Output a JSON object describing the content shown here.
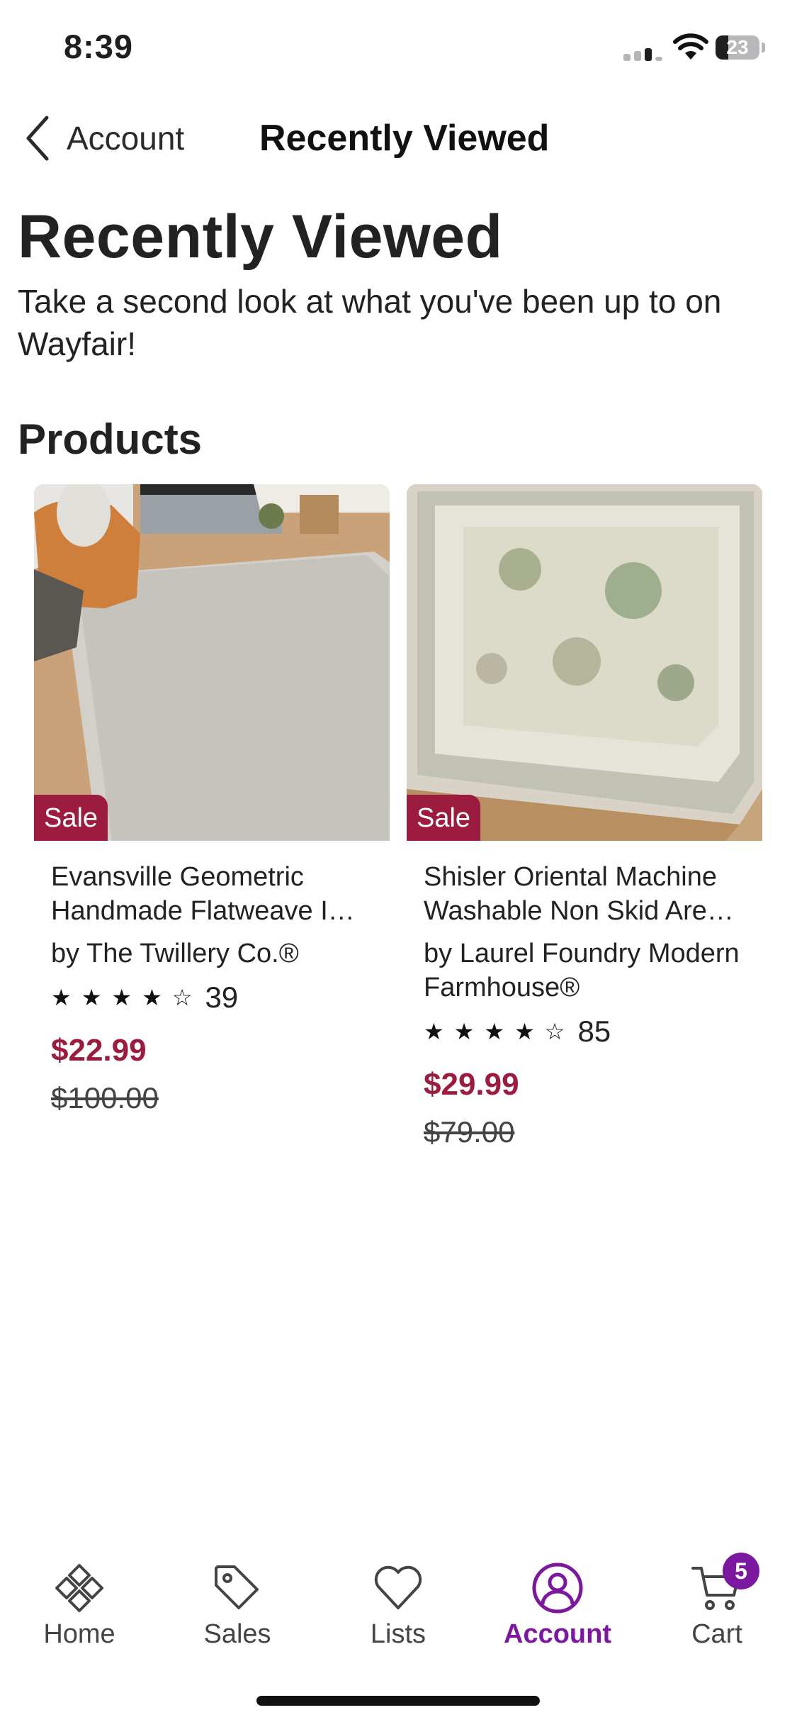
{
  "status_bar": {
    "time": "8:39",
    "battery": "23"
  },
  "nav": {
    "back_label": "Account",
    "title": "Recently Viewed"
  },
  "page": {
    "title": "Recently Viewed",
    "subtitle": "Take a second look at what you've been up to on Wayfair!",
    "section_title": "Products"
  },
  "products": [
    {
      "badge": "Sale",
      "name": "Evansville Geometric Handmade Flatweave I…",
      "brand": "by The Twillery Co.®",
      "stars": "★★★★☆",
      "rating": 4,
      "review_count": "39",
      "price": "$22.99",
      "original_price": "$100.00"
    },
    {
      "badge": "Sale",
      "name": "Shisler Oriental Machine Washable Non Skid Are…",
      "brand": "by Laurel Foundry Modern Farmhouse®",
      "stars": "★★★★☆",
      "rating": 4,
      "review_count": "85",
      "price": "$29.99",
      "original_price": "$79.00"
    }
  ],
  "tab_bar": {
    "tabs": [
      {
        "label": "Home",
        "icon": "home-icon"
      },
      {
        "label": "Sales",
        "icon": "tag-icon"
      },
      {
        "label": "Lists",
        "icon": "heart-icon"
      },
      {
        "label": "Account",
        "icon": "account-icon",
        "active": true
      },
      {
        "label": "Cart",
        "icon": "cart-icon"
      }
    ],
    "cart_badge": "5"
  },
  "colors": {
    "accent": "#7b189f",
    "sale": "#9b1c3f",
    "text": "#1f1f22"
  }
}
